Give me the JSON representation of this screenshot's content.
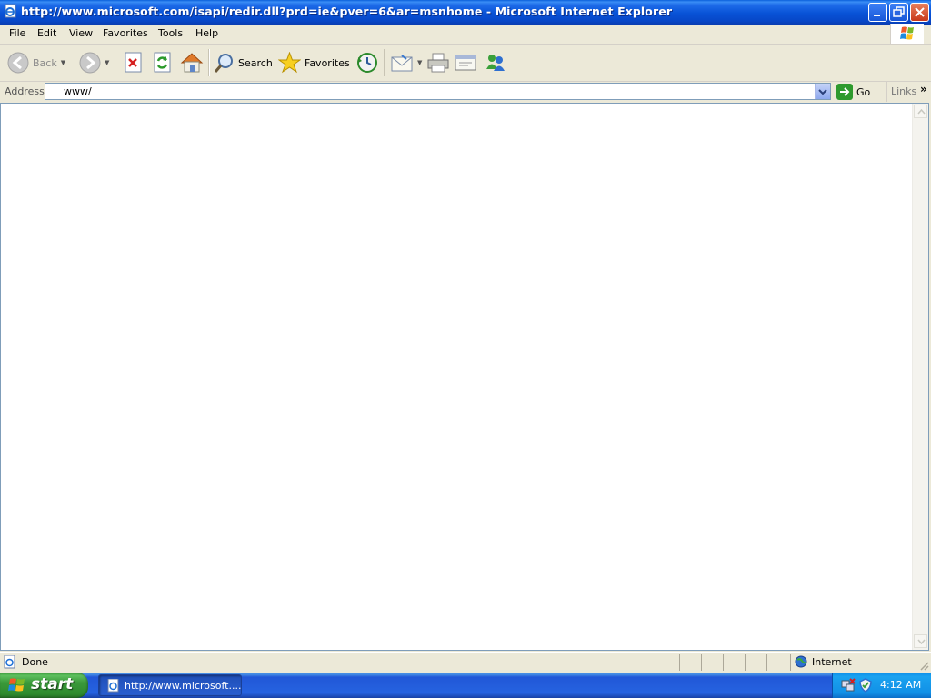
{
  "window": {
    "title": "http://www.microsoft.com/isapi/redir.dll?prd=ie&pver=6&ar=msnhome - Microsoft Internet Explorer"
  },
  "menubar": {
    "items": [
      "File",
      "Edit",
      "View",
      "Favorites",
      "Tools",
      "Help"
    ]
  },
  "toolbar": {
    "back_label": "Back",
    "search_label": "Search",
    "favorites_label": "Favorites"
  },
  "address": {
    "label": "Address",
    "value": "www/",
    "go_label": "Go",
    "links_label": "Links"
  },
  "status": {
    "text": "Done",
    "zone": "Internet"
  },
  "taskbar": {
    "start_label": "start",
    "task_label": "http://www.microsoft....",
    "clock": "4:12 AM"
  },
  "colors": {
    "titlebar": "#0852D6",
    "taskbar": "#2663E0",
    "start_button": "#3A993A",
    "window_face": "#ECE9D8"
  },
  "icons": [
    "ie-page-icon",
    "minimize-icon",
    "restore-icon",
    "close-icon",
    "windows-flag-icon",
    "back-icon",
    "forward-icon",
    "stop-icon",
    "refresh-icon",
    "home-icon",
    "search-icon",
    "favorites-star-icon",
    "history-icon",
    "mail-icon",
    "print-icon",
    "edit-icon",
    "messenger-icon",
    "go-arrow-icon",
    "globe-icon",
    "network-icon",
    "shield-icon"
  ]
}
